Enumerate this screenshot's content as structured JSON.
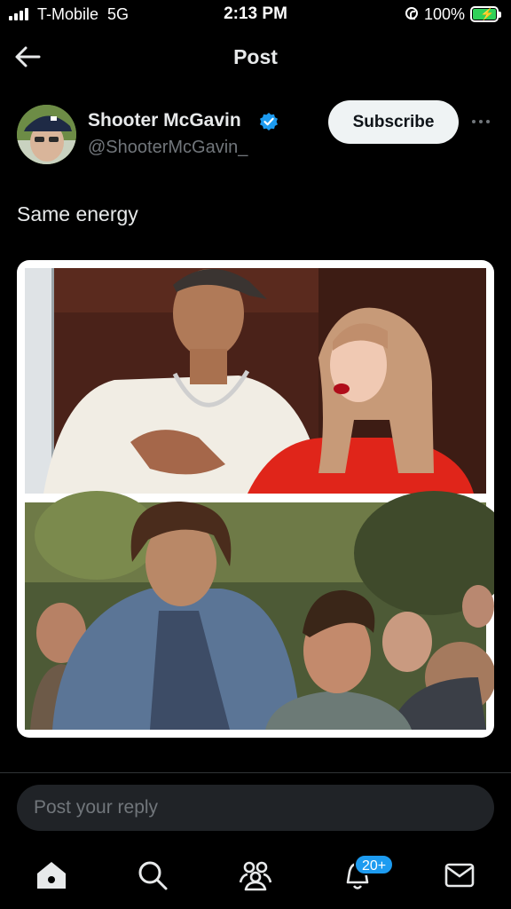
{
  "status": {
    "carrier": "T-Mobile",
    "network": "5G",
    "time": "2:13 PM",
    "battery": "100%"
  },
  "header": {
    "title": "Post"
  },
  "author": {
    "name": "Shooter McGavin",
    "handle": "@ShooterMcGavin_",
    "verified": true
  },
  "actions": {
    "subscribe": "Subscribe"
  },
  "post": {
    "text": "Same energy"
  },
  "reply": {
    "placeholder": "Post your reply"
  },
  "tabbar": {
    "items": [
      "home-icon",
      "search-icon",
      "communities-icon",
      "notifications-icon",
      "messages-icon"
    ],
    "notifications_badge": "20+"
  },
  "colors": {
    "accent": "#1d9bf0",
    "background": "#000000",
    "muted": "#71767b",
    "battery": "#30d158"
  }
}
